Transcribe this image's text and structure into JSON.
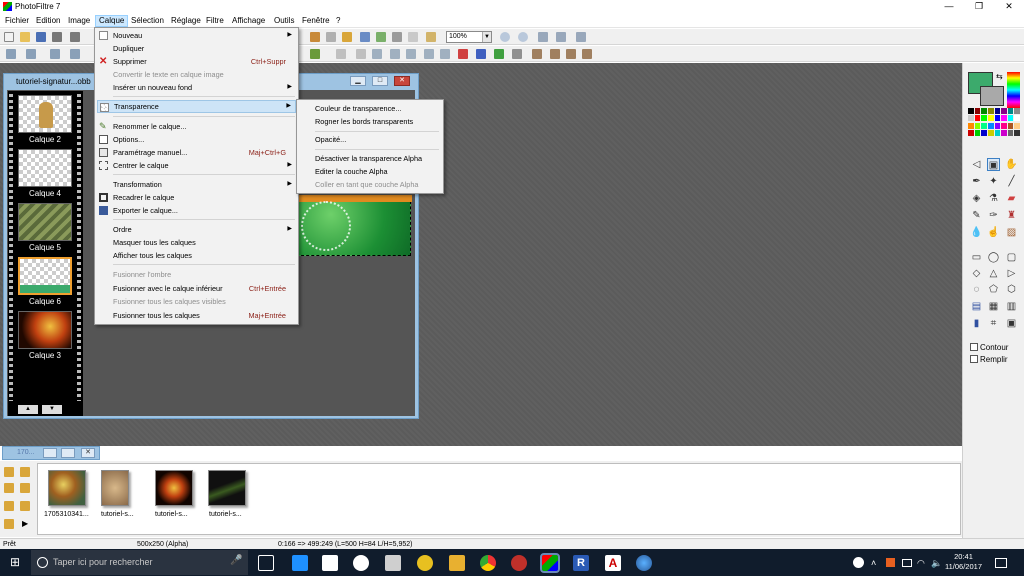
{
  "app": {
    "title": "PhotoFiltre 7"
  },
  "menubar": [
    "Fichier",
    "Edition",
    "Image",
    "Calque",
    "Sélection",
    "Réglage",
    "Filtre",
    "Affichage",
    "Outils",
    "Fenêtre",
    "?"
  ],
  "zoom": "100%",
  "document": {
    "title": "tutoriel-signatur...obb"
  },
  "layers": [
    {
      "name": "Calque 2"
    },
    {
      "name": "Calque 4"
    },
    {
      "name": "Calque 5"
    },
    {
      "name": "Calque 6"
    },
    {
      "name": "Calque 3"
    }
  ],
  "calque_menu": [
    {
      "label": "Nouveau",
      "shortcut": "",
      "disabled": false,
      "submenu": true
    },
    {
      "label": "Dupliquer",
      "shortcut": "",
      "disabled": false,
      "submenu": false
    },
    {
      "label": "Supprimer",
      "shortcut": "Ctrl+Suppr",
      "disabled": false,
      "submenu": false
    },
    {
      "label": "Convertir le texte en calque image",
      "shortcut": "",
      "disabled": true,
      "submenu": false
    },
    {
      "label": "Insérer un nouveau fond",
      "shortcut": "",
      "disabled": false,
      "submenu": true
    },
    {
      "label": "Transparence",
      "shortcut": "",
      "disabled": false,
      "submenu": true
    },
    {
      "label": "Renommer le calque...",
      "shortcut": "",
      "disabled": false,
      "submenu": false
    },
    {
      "label": "Options...",
      "shortcut": "",
      "disabled": false,
      "submenu": false
    },
    {
      "label": "Paramétrage manuel...",
      "shortcut": "Maj+Ctrl+G",
      "disabled": false,
      "submenu": false
    },
    {
      "label": "Centrer le calque",
      "shortcut": "",
      "disabled": false,
      "submenu": true
    },
    {
      "label": "Transformation",
      "shortcut": "",
      "disabled": false,
      "submenu": true
    },
    {
      "label": "Recadrer le calque",
      "shortcut": "",
      "disabled": false,
      "submenu": false
    },
    {
      "label": "Exporter le calque...",
      "shortcut": "",
      "disabled": false,
      "submenu": false
    },
    {
      "label": "Ordre",
      "shortcut": "",
      "disabled": false,
      "submenu": true
    },
    {
      "label": "Masquer tous les calques",
      "shortcut": "",
      "disabled": false,
      "submenu": false
    },
    {
      "label": "Afficher tous les calques",
      "shortcut": "",
      "disabled": false,
      "submenu": false
    },
    {
      "label": "Fusionner l'ombre",
      "shortcut": "",
      "disabled": true,
      "submenu": false
    },
    {
      "label": "Fusionner avec le calque inférieur",
      "shortcut": "Ctrl+Entrée",
      "disabled": false,
      "submenu": false
    },
    {
      "label": "Fusionner tous les calques visibles",
      "shortcut": "",
      "disabled": true,
      "submenu": false
    },
    {
      "label": "Fusionner tous les calques",
      "shortcut": "Maj+Entrée",
      "disabled": false,
      "submenu": false
    }
  ],
  "transparence_submenu": [
    {
      "label": "Couleur de transparence...",
      "disabled": false
    },
    {
      "label": "Rogner les bords transparents",
      "disabled": false
    },
    {
      "label": "Opacité...",
      "disabled": false
    },
    {
      "label": "Désactiver la transparence Alpha",
      "disabled": false
    },
    {
      "label": "Editer la couche Alpha",
      "disabled": false
    },
    {
      "label": "Coller en tant que couche Alpha",
      "disabled": true
    }
  ],
  "options": {
    "contour": "Contour",
    "remplir": "Remplir"
  },
  "filmstrip": {
    "window_title": "170...",
    "files": [
      "1705310341...",
      "tutoriel-s...",
      "tutoriel-s...",
      "tutoriel-s..."
    ]
  },
  "status": {
    "ready": "Prêt",
    "size": "500x250 (Alpha)",
    "coords": "0:166 => 499:249 (L=500  H=84  L/H=5,952)"
  },
  "taskbar": {
    "search_placeholder": "Taper ici pour rechercher",
    "time": "20:41",
    "date": "11/06/2017"
  },
  "colors": {
    "foreground": "#3caa6c",
    "background": "#a9a9a9",
    "menu_highlight": "#cde4f7",
    "shortcut": "#8b1f16"
  }
}
